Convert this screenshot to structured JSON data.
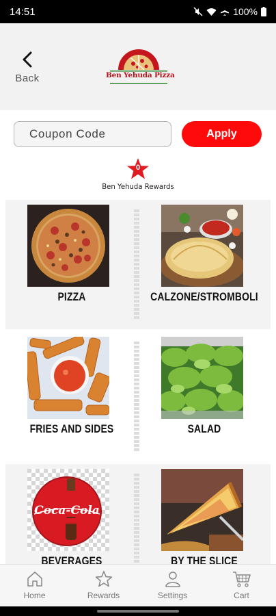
{
  "status_bar": {
    "time": "14:51",
    "battery": "100%"
  },
  "header": {
    "back_label": "Back",
    "logo_text": "Ben Yehuda Pizza"
  },
  "coupon": {
    "placeholder": "Coupon Code",
    "apply_label": "Apply"
  },
  "rewards": {
    "count": "0",
    "label": "Ben Yehuda Rewards"
  },
  "menu": {
    "categories": [
      {
        "label": "PIZZA",
        "icon": "pizza-photo"
      },
      {
        "label": "CALZONE/STROMBOLI",
        "icon": "calzone-photo"
      },
      {
        "label": "FRIES AND SIDES",
        "icon": "fries-photo"
      },
      {
        "label": "SALAD",
        "icon": "salad-photo"
      },
      {
        "label": "BEVERAGES",
        "icon": "coca-cola-photo"
      },
      {
        "label": "BY THE SLICE",
        "icon": "slice-photo"
      }
    ],
    "coca_cola_logo": "Coca-Cola"
  },
  "bottom_nav": {
    "items": [
      {
        "label": "Home",
        "icon": "home-icon"
      },
      {
        "label": "Rewards",
        "icon": "star-icon"
      },
      {
        "label": "Settings",
        "icon": "person-icon"
      },
      {
        "label": "Cart",
        "icon": "cart-icon"
      }
    ]
  },
  "colors": {
    "brand_red": "#ff0a0a",
    "logo_red": "#b3121b"
  }
}
